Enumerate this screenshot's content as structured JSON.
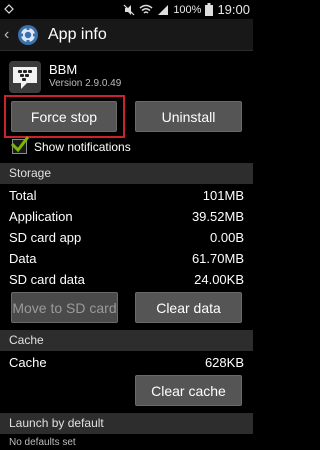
{
  "status_bar": {
    "battery": "100%",
    "time": "19:00",
    "icons": [
      "notification-icon",
      "mute-icon",
      "wifi-icon",
      "signal-icon",
      "battery-icon"
    ]
  },
  "action_bar": {
    "title": "App info"
  },
  "app": {
    "name": "BBM",
    "version": "Version 2.9.0.49"
  },
  "buttons": {
    "force_stop": "Force stop",
    "uninstall": "Uninstall",
    "move_to_sd": "Move to SD card",
    "clear_data": "Clear data",
    "clear_cache": "Clear cache"
  },
  "show_notifications": {
    "label": "Show notifications",
    "checked": true
  },
  "storage": {
    "header": "Storage",
    "rows": [
      {
        "label": "Total",
        "value": "101MB"
      },
      {
        "label": "Application",
        "value": "39.52MB"
      },
      {
        "label": "SD card app",
        "value": "0.00B"
      },
      {
        "label": "Data",
        "value": "61.70MB"
      },
      {
        "label": "SD card data",
        "value": "24.00KB"
      }
    ]
  },
  "cache": {
    "header": "Cache",
    "rows": [
      {
        "label": "Cache",
        "value": "628KB"
      }
    ]
  },
  "launch": {
    "header": "Launch by default",
    "text": "No defaults set"
  },
  "colors": {
    "highlight": "#c8242f",
    "check": "#7ab800"
  }
}
